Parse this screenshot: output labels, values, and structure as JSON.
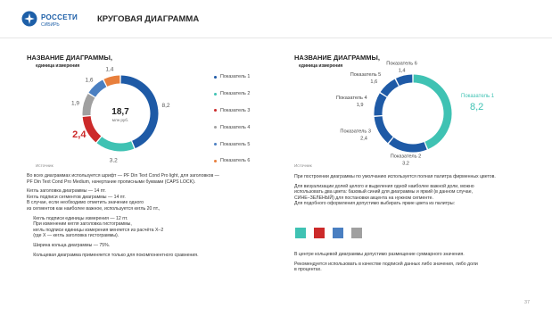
{
  "header": {
    "brand": "РОССЕТИ",
    "brand_sub": "СИБИРЬ",
    "title": "КРУГОВАЯ ДИАГРАММА"
  },
  "left_chart": {
    "title_line1": "НАЗВАНИЕ ДИАГРАММЫ,",
    "unit": "единица измерения",
    "center_value": "18,7",
    "center_unit": "млн руб.",
    "source": "Источник"
  },
  "right_chart": {
    "title_line1": "НАЗВАНИЕ ДИАГРАММЫ,",
    "unit": "единица измерения",
    "source": "Источник"
  },
  "chart_data": [
    {
      "type": "pie",
      "variant": "donut",
      "total": 18.7,
      "total_label": "18,7",
      "center_unit": "млн руб.",
      "categories": [
        "Показатель 1",
        "Показатель 2",
        "Показатель 3",
        "Показатель 4",
        "Показатель 5",
        "Показатель 6"
      ],
      "values": [
        8.2,
        3.2,
        2.4,
        1.9,
        1.6,
        1.4
      ],
      "value_labels": [
        "8,2",
        "3,2",
        "2,4",
        "1,9",
        "1,6",
        "1,4"
      ],
      "colors": [
        "#1e5aa6",
        "#3fc2b3",
        "#cc2a2a",
        "#a0a0a0",
        "#4a7fc1",
        "#e87f3c"
      ],
      "label_colors": [
        "#555",
        "#555",
        "#cc2a2a",
        "#555",
        "#555",
        "#555"
      ],
      "legend": "right"
    },
    {
      "type": "pie",
      "variant": "donut",
      "categories": [
        "Показатель 1",
        "Показатель 2",
        "Показатель 3",
        "Показатель 4",
        "Показатель 5",
        "Показатель 6"
      ],
      "values": [
        8.2,
        3.2,
        2.4,
        1.9,
        1.6,
        1.4
      ],
      "value_labels": [
        "8,2",
        "3,2",
        "2,4",
        "1,9",
        "1,6",
        "1,4"
      ],
      "colors": [
        "#3fc2b3",
        "#1e5aa6",
        "#1e5aa6",
        "#1e5aa6",
        "#1e5aa6",
        "#1e5aa6"
      ],
      "highlighted": "Показатель 1",
      "legend": "none"
    }
  ],
  "legend_items": [
    {
      "label": "Показатель 1",
      "color": "#1e5aa6"
    },
    {
      "label": "Показатель 2",
      "color": "#3fc2b3"
    },
    {
      "label": "Показатель 3",
      "color": "#cc2a2a"
    },
    {
      "label": "Показатель 4",
      "color": "#a0a0a0"
    },
    {
      "label": "Показатель 5",
      "color": "#4a7fc1"
    },
    {
      "label": "Показатель 6",
      "color": "#e87f3c"
    }
  ],
  "left_text": [
    "Во всех диаграммах используется шрифт — PF Din Text Cond Pro light, для заголовков —",
    "PF Din Text Cond Pro Medium, начертание прописными буквами (CAPS LOCK).",
    "",
    "Кегль заголовка диаграммы — 14 пт.",
    "Кегль подписи сегментов диаграммы — 14 пт.",
    "В случае, если необходимо отметить значение одного",
    "из сегментов как наиболее важное, используется кегль 20 пт.,",
    "",
    "     Кегль подписи единицы измерения — 12 пт.",
    "     При изменении кегля заголовка гистограммы,",
    "     кегль подписи единицы измерения меняется из расчёта X–2",
    "     (где X — кегль заголовка гистограммы).",
    "",
    "     Ширина кольца диаграммы — 75%.",
    "",
    "     Кольцевая диаграмма применяется только для покомпонентного сравнения."
  ],
  "right_text_top": [
    "При построении диаграммы по умолчанию используется полная палитра фирменных цветов.",
    "",
    "Для визуализации долей целого и выделения одной наиболее важной доли, можно",
    "использовать два цвета: базовый синий для диаграммы и яркий (в данном случае,",
    "СИНЕ–ЗЕЛЕНЫЙ) для постановки акцента на нужном сегменте.",
    "Для подобного оформления допустимо выбирать яркие цвета из палитры:"
  ],
  "swatch_colors": [
    "#3fc2b3",
    "#cc2a2a",
    "#4a7fc1",
    "#a0a0a0"
  ],
  "right_text_bottom": [
    "В центре кольцевой диаграммы допустимо размещение суммарного значения.",
    "",
    "Рекомендуется использовать в качестве подписей данных либо значения, либо доли",
    "в процентах."
  ],
  "page_number": "37"
}
